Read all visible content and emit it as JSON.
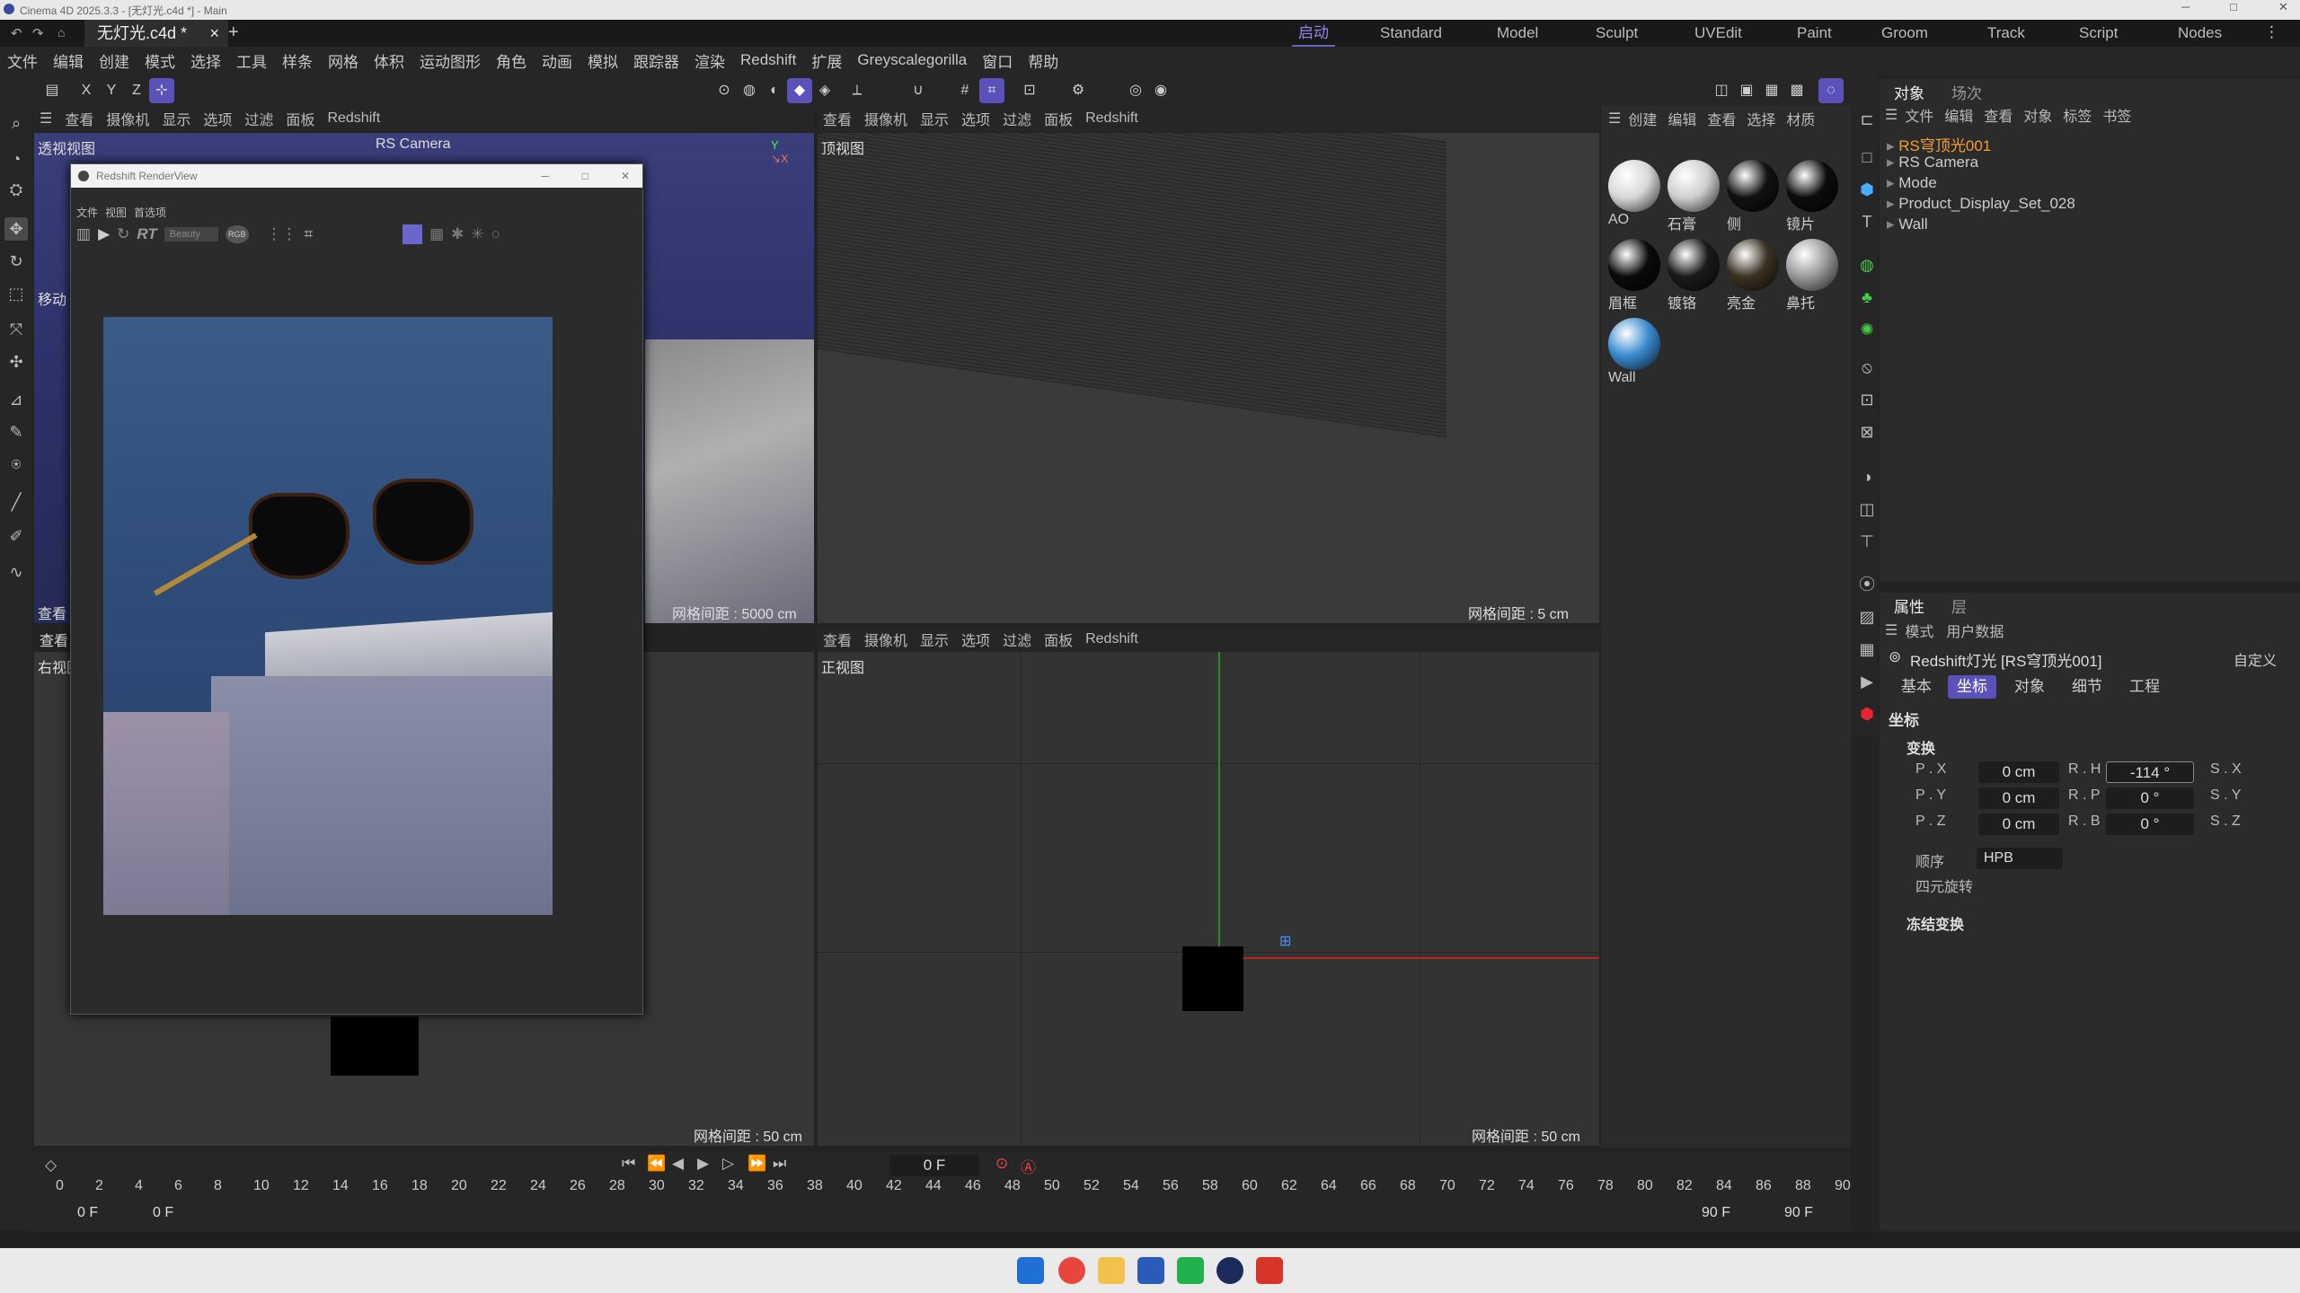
{
  "window": {
    "title": "Cinema 4D 2025.3.3 - [无灯光.c4d *] - Main"
  },
  "tabs": {
    "doc": "无灯光.c4d *",
    "close": "×",
    "add": "+"
  },
  "layouts": [
    "启动",
    "Standard",
    "Model",
    "Sculpt",
    "UVEdit",
    "Paint",
    "Groom",
    "Track",
    "Script",
    "Nodes"
  ],
  "menu": [
    "文件",
    "编辑",
    "创建",
    "模式",
    "选择",
    "工具",
    "样条",
    "网格",
    "体积",
    "运动图形",
    "角色",
    "动画",
    "模拟",
    "跟踪器",
    "渲染",
    "Redshift",
    "扩展",
    "Greyscalegorilla",
    "窗口",
    "帮助"
  ],
  "axes": {
    "x": "X",
    "y": "Y",
    "z": "Z"
  },
  "viewport_menu": [
    "查看",
    "摄像机",
    "显示",
    "选项",
    "过滤",
    "面板",
    "Redshift"
  ],
  "viewports": {
    "persp": {
      "label": "透视视图",
      "camera": "RS Camera",
      "move": "移动",
      "grid": "网格间距 : 5000 cm",
      "bottom": "查看"
    },
    "top": {
      "label": "顶视图",
      "grid": "网格间距 : 5 cm"
    },
    "right": {
      "label": "右视图",
      "grid": "网格间距 : 50 cm",
      "head": "查看"
    },
    "front": {
      "label": "正视图",
      "grid": "网格间距 : 50 cm"
    }
  },
  "renderview": {
    "title": "Redshift RenderView",
    "menu": [
      "文件",
      "视图",
      "首选项"
    ],
    "rt": "RT",
    "aov": "Beauty",
    "rgb": "RGB"
  },
  "materials": {
    "menu": [
      "创建",
      "编辑",
      "查看",
      "选择",
      "材质"
    ],
    "items": [
      {
        "name": "AO",
        "color": "#d8d8d8"
      },
      {
        "name": "石膏",
        "color": "#cfcfcf"
      },
      {
        "name": "侧",
        "color": "#111111"
      },
      {
        "name": "镜片",
        "color": "#0c0c0c"
      },
      {
        "name": "眉框",
        "color": "#0a0a0a"
      },
      {
        "name": "镀铬",
        "color": "#1a1a1a"
      },
      {
        "name": "亮金",
        "color": "#3a3222"
      },
      {
        "name": "鼻托",
        "color": "#9a9a9a"
      },
      {
        "name": "Wall",
        "color": "#3a8bd0"
      }
    ]
  },
  "objects": {
    "tabs": [
      "对象",
      "场次"
    ],
    "menu": [
      "文件",
      "编辑",
      "查看",
      "对象",
      "标签",
      "书签"
    ],
    "items": [
      {
        "name": "RS穹顶光001",
        "color": "#f0a030"
      },
      {
        "name": "RS Camera",
        "color": "#ccc"
      },
      {
        "name": "Mode",
        "color": "#ccc"
      },
      {
        "name": "Product_Display_Set_028",
        "color": "#ccc"
      },
      {
        "name": "Wall",
        "color": "#ccc"
      }
    ]
  },
  "attributes": {
    "tabs": [
      "属性",
      "层"
    ],
    "menu": [
      "模式",
      "用户数据"
    ],
    "object_title": "Redshift灯光 [RS穹顶光001]",
    "preset": "自定义",
    "mode_tabs": [
      "基本",
      "坐标",
      "对象",
      "细节",
      "工程"
    ],
    "section": "坐标",
    "transform": "变换",
    "rows": [
      {
        "p": "P . X",
        "pv": "0 cm",
        "r": "R . H",
        "rv": "-114 °",
        "s": "S . X"
      },
      {
        "p": "P . Y",
        "pv": "0 cm",
        "r": "R . P",
        "rv": "0 °",
        "s": "S . Y"
      },
      {
        "p": "P . Z",
        "pv": "0 cm",
        "r": "R . B",
        "rv": "0 °",
        "s": "S . Z"
      }
    ],
    "order_label": "顺序",
    "order_value": "HPB",
    "quat": "四元旋转",
    "freeze": "冻结变换"
  },
  "timeline": {
    "current": "0 F",
    "ticks": [
      "0",
      "2",
      "4",
      "6",
      "8",
      "10",
      "12",
      "14",
      "16",
      "18",
      "20",
      "22",
      "24",
      "26",
      "28",
      "30",
      "32",
      "34",
      "36",
      "38",
      "40",
      "42",
      "44",
      "46",
      "48",
      "50",
      "52",
      "54",
      "56",
      "58",
      "60",
      "62",
      "64",
      "66",
      "68",
      "70",
      "72",
      "74",
      "76",
      "78",
      "80",
      "82",
      "84",
      "86",
      "88",
      "90"
    ],
    "start": "0 F",
    "start2": "0 F",
    "end": "90 F",
    "end2": "90 F"
  }
}
